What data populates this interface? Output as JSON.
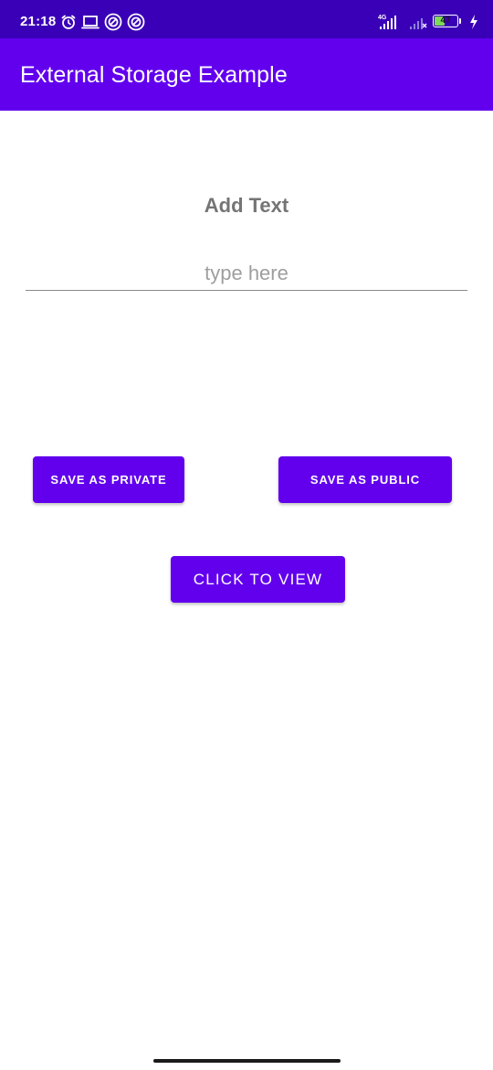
{
  "status_bar": {
    "time": "21:18",
    "network_type": "4G",
    "battery_level": "47",
    "left_icons": [
      "alarm-icon",
      "laptop-icon",
      "app-notification-icon",
      "app-notification-icon"
    ],
    "right_icons": [
      "signal-4g-icon",
      "signal-no-sim-icon",
      "battery-icon",
      "charging-icon"
    ]
  },
  "app_bar": {
    "title": "External Storage Example",
    "color": "#6200ee"
  },
  "main": {
    "heading": "Add Text",
    "input": {
      "placeholder": "type here",
      "value": ""
    },
    "buttons": {
      "save_private": "SAVE AS PRIVATE",
      "save_public": "SAVE AS PUBLIC",
      "view": "CLICK TO VIEW"
    }
  },
  "colors": {
    "status_bar": "#3a00b8",
    "primary": "#6200ee",
    "heading_text": "#757575"
  }
}
